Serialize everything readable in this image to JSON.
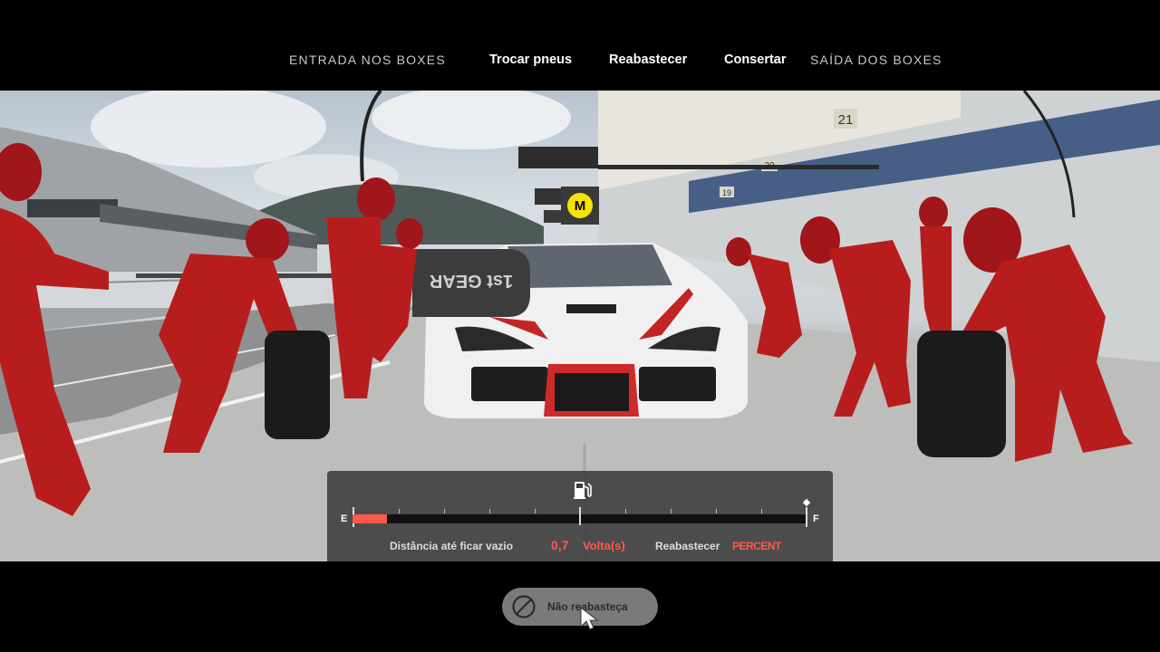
{
  "menu": {
    "steps": [
      {
        "label": "ENTRADA NOS BOXES"
      },
      {
        "label": "SAÍDA DOS BOXES"
      }
    ],
    "actions": [
      {
        "label": "Trocar pneus"
      },
      {
        "label": "Reabastecer"
      },
      {
        "label": "Consertar"
      }
    ]
  },
  "scene": {
    "marker_letter": "M",
    "pit_number": "21",
    "garage_numbers": [
      "20",
      "19"
    ],
    "board_text": "1st GEAR"
  },
  "refuel": {
    "icon": "fuel-pump-icon",
    "gauge_empty_label": "E",
    "gauge_full_label": "F",
    "fuel_level_fraction": 0.075,
    "distance_label": "Distância até ficar vazio",
    "distance_value": "0,7",
    "distance_unit": "Volta(s)",
    "refuel_label": "Reabastecer",
    "refuel_mode": "PERCENT",
    "accent_color": "#ff5a4a"
  },
  "bottom": {
    "no_refuel_label": "Não reabasteça",
    "no_refuel_icon": "prohibited-icon"
  }
}
